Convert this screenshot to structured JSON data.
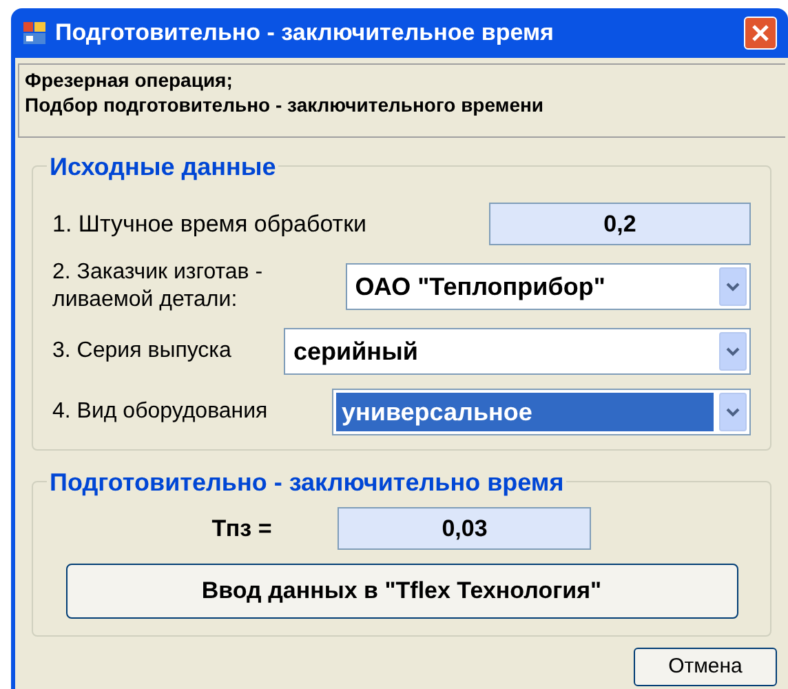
{
  "window": {
    "title": "Подготовительно - заключительное время"
  },
  "info": {
    "lines": [
      "Фрезерная операция;",
      "Подбор подготовительно - заключительного времени"
    ]
  },
  "source_group": {
    "title": "Исходные данные",
    "fields": [
      {
        "kind": "readonly",
        "label": "1. Штучное время обработки",
        "value": "0,2"
      },
      {
        "kind": "combo",
        "label": "2. Заказчик изготав - ливаемой детали:",
        "value": "ОАО \"Теплоприбор\"",
        "highlighted": false
      },
      {
        "kind": "combo",
        "label": "3. Серия выпуска",
        "value": "серийный",
        "highlighted": false
      },
      {
        "kind": "combo",
        "label": "4. Вид оборудования",
        "value": "универсальное",
        "highlighted": true
      }
    ]
  },
  "result_group": {
    "title": "Подготовительно - заключительно время",
    "label": "Тпз =",
    "value": "0,03",
    "button": "Ввод данных в \"Tflex Технология\""
  },
  "buttons": [
    "Отмена"
  ]
}
